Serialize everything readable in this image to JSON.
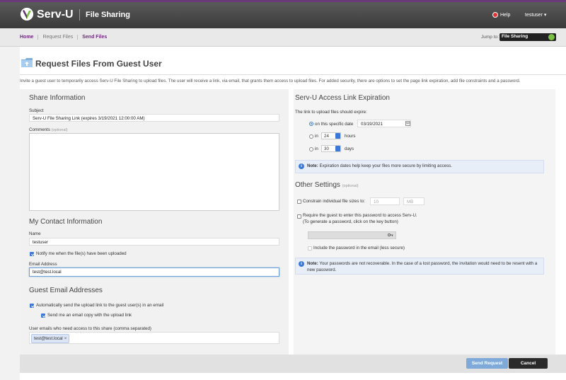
{
  "header": {
    "logo_text": "Serv-U",
    "app_title": "File Sharing",
    "help_label": "Help",
    "user_label": "testuser ▾"
  },
  "nav": {
    "links": [
      "Home",
      "Request Files",
      "Send Files"
    ],
    "jump_label": "Jump to:",
    "jump_value": "File Sharing"
  },
  "page": {
    "title": "Request Files From Guest User",
    "description": "Invite a guest user to temporarily access Serv-U File Sharing to upload files. The user will receive a link, via email, that grants them access to upload files. For added security, there are options to set the page link expiration, add file constraints and a password."
  },
  "share": {
    "title": "Share Information",
    "subject_label": "Subject",
    "subject_value": "Serv-U File Sharing Link (expires 3/19/2021 12:00:00 AM)",
    "comments_label": "Comments",
    "comments_optional": "(optional)"
  },
  "contact": {
    "title": "My Contact Information",
    "name_label": "Name",
    "name_value": "testuser",
    "notify_label": "Notify me when the file(s) have been uploaded",
    "email_label": "Email Address",
    "email_value": "test@test.local"
  },
  "guest": {
    "title": "Guest Email Addresses",
    "auto_send_label": "Automatically send the upload link to the guest user(s) in an email",
    "copy_label": "Send me an email copy with the upload link",
    "emails_label": "User emails who need access to this share (comma separated)",
    "tag_value": "test@test.local",
    "tag_remove": "×"
  },
  "expiration": {
    "title": "Serv-U Access Link Expiration",
    "intro": "The link to upload files should expire:",
    "option_date_label": "on this specific date",
    "date_value": "03/19/2021",
    "option_hours_prefix": "in",
    "hours_value": "24",
    "hours_unit": "hours",
    "option_days_prefix": "in",
    "days_value": "30",
    "days_unit": "days",
    "note_bold": "Note:",
    "note_text": "Expiration dates help keep your files more secure by limiting access."
  },
  "other": {
    "title": "Other Settings",
    "optional": "(optional)",
    "constrain_label": "Constrain individual file sizes to:",
    "size_value": "10",
    "size_unit": "MB",
    "password_label": "Require the guest to enter this password to access Serv-U.",
    "password_hint": "(To generate a password, click on the key button)",
    "include_label": "Include the password in the email (less secure)",
    "note_bold": "Note:",
    "note_text": "Your passwords are not recoverable. In the case of a lost password, the invitation would need to be resent with a new password."
  },
  "footer": {
    "send_label": "Send Request",
    "cancel_label": "Cancel"
  },
  "colors": {
    "brand": "#6b2d7b",
    "accent": "#3b78d8",
    "jump_button": "#7ac143"
  }
}
